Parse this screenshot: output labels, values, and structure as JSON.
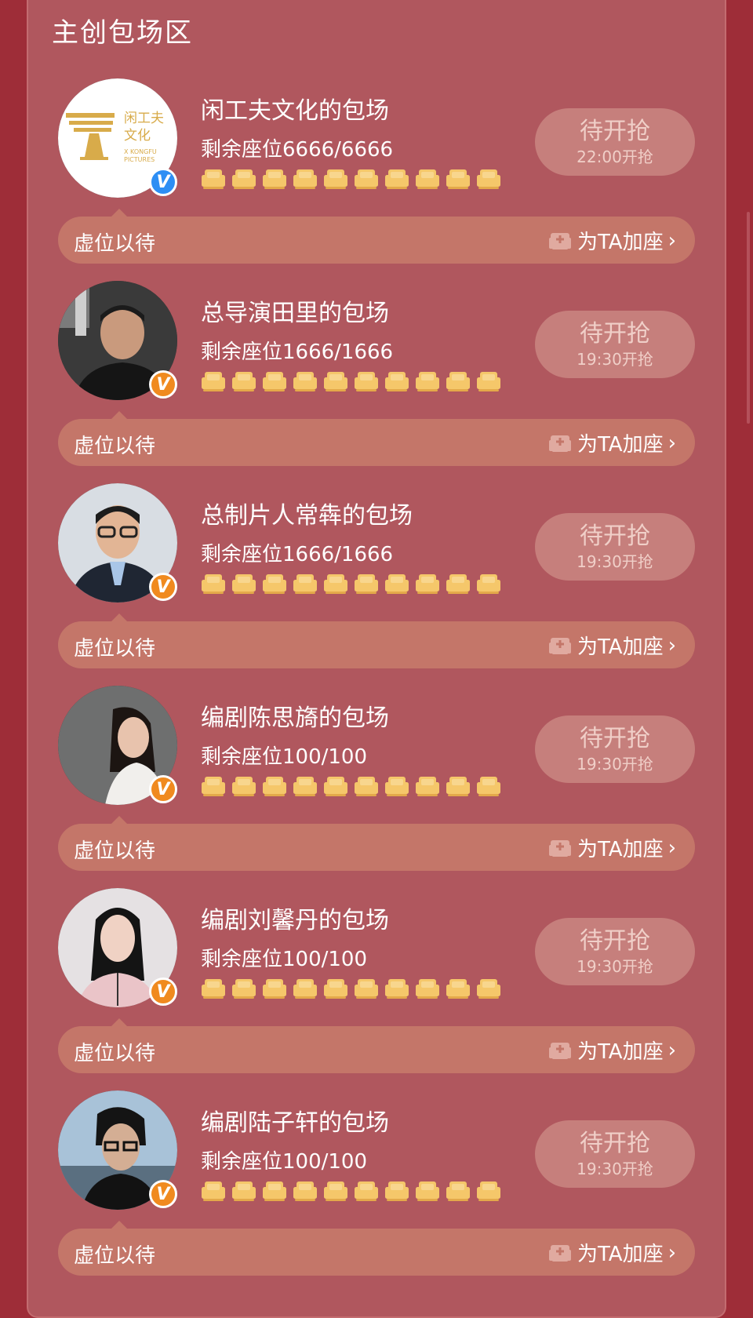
{
  "section": {
    "title": "主创包场区"
  },
  "colors": {
    "page_bg": "#9e2d38",
    "panel_bg": "#b0575e",
    "button_bg": "#c67f7c",
    "bar_bg": "#c47669",
    "seat": "#f5c76a",
    "verified_orange": "#f08a1f",
    "verified_blue": "#2d8ef4"
  },
  "items": [
    {
      "title": "闲工夫文化的包场",
      "seats": "剩余座位6666/6666",
      "button_main": "待开抢",
      "button_time": "22:00开抢",
      "bar_text": "虚位以待",
      "bar_action": "为TA加座",
      "badge": "blue",
      "avatar": "logo-xiangongfu",
      "logo_cn": "闲工夫",
      "logo_cn2": "文化",
      "logo_en1": "X KONGFU",
      "logo_en2": "PICTURES"
    },
    {
      "title": "总导演田里的包场",
      "seats": "剩余座位1666/1666",
      "button_main": "待开抢",
      "button_time": "19:30开抢",
      "bar_text": "虚位以待",
      "bar_action": "为TA加座",
      "badge": "orange",
      "avatar": "person-dark"
    },
    {
      "title": "总制片人常犇的包场",
      "seats": "剩余座位1666/1666",
      "button_main": "待开抢",
      "button_time": "19:30开抢",
      "bar_text": "虚位以待",
      "bar_action": "为TA加座",
      "badge": "orange",
      "avatar": "person-glasses"
    },
    {
      "title": "编剧陈思旖的包场",
      "seats": "剩余座位100/100",
      "button_main": "待开抢",
      "button_time": "19:30开抢",
      "bar_text": "虚位以待",
      "bar_action": "为TA加座",
      "badge": "orange",
      "avatar": "person-woman-grey"
    },
    {
      "title": "编剧刘馨丹的包场",
      "seats": "剩余座位100/100",
      "button_main": "待开抢",
      "button_time": "19:30开抢",
      "bar_text": "虚位以待",
      "bar_action": "为TA加座",
      "badge": "orange",
      "avatar": "person-woman-light"
    },
    {
      "title": "编剧陆子轩的包场",
      "seats": "剩余座位100/100",
      "button_main": "待开抢",
      "button_time": "19:30开抢",
      "bar_text": "虚位以待",
      "bar_action": "为TA加座",
      "badge": "orange",
      "avatar": "person-outdoor"
    }
  ]
}
